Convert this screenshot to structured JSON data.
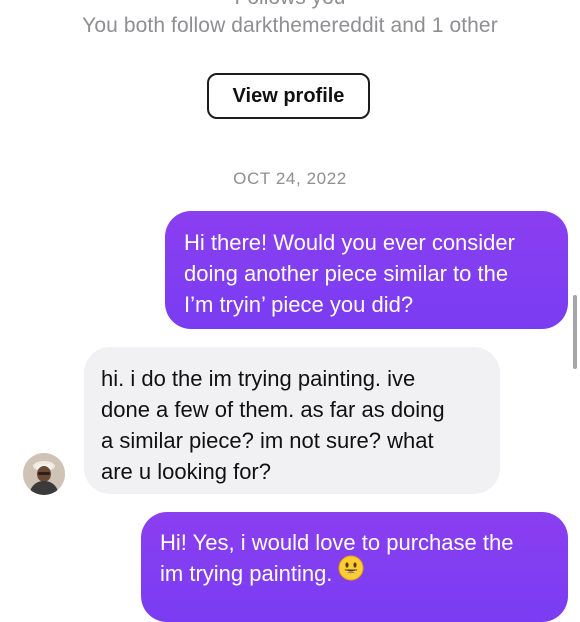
{
  "header": {
    "follows_you": "Follows you",
    "mutual_follow": "You both follow darkthemereddit and 1 other",
    "view_profile_label": "View profile"
  },
  "thread": {
    "date_separator": "OCT 24, 2022",
    "messages": [
      {
        "sender": "me",
        "lines": [
          "Hi there! Would you ever consider",
          "doing another piece similar to the",
          "I’m tryin’ piece you did?"
        ]
      },
      {
        "sender": "them",
        "lines": [
          "hi. i do the im trying painting. ive",
          "done a few of them. as far as doing",
          "a similar piece? im not sure? what",
          "are u looking for?"
        ]
      },
      {
        "sender": "me",
        "lines": [
          "Hi! Yes, i would love to purchase the",
          "im trying painting."
        ],
        "emoji": "smiling-face-emoji"
      }
    ]
  },
  "colors": {
    "sent_bubble": "#7a3cf2",
    "received_bubble": "#f1f1f3",
    "meta_text": "#8e8e93"
  },
  "icons": {
    "avatar": "profile-avatar",
    "emoji": "smiling-face-emoji"
  }
}
